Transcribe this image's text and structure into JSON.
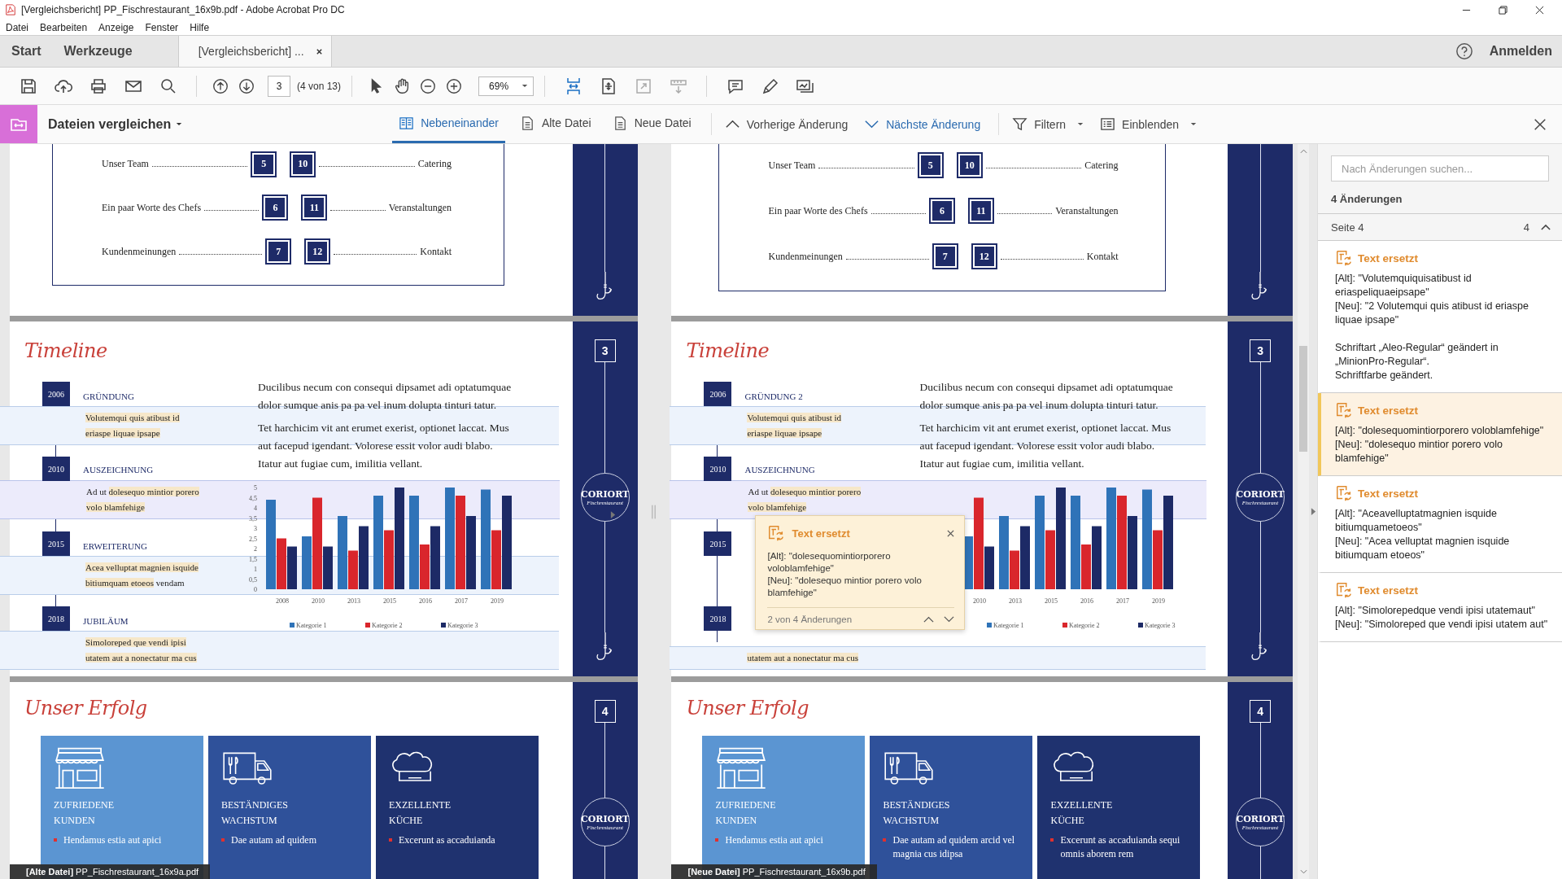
{
  "window": {
    "title": "[Vergleichsbericht] PP_Fischrestaurant_16x9b.pdf - Adobe Acrobat Pro DC"
  },
  "menu": [
    "Datei",
    "Bearbeiten",
    "Anzeige",
    "Fenster",
    "Hilfe"
  ],
  "tabs": [
    {
      "label": "Start",
      "selected": false,
      "kind": "home"
    },
    {
      "label": "Werkzeuge",
      "selected": false,
      "kind": "home"
    },
    {
      "label": "[Vergleichsbericht] ...",
      "selected": true,
      "kind": "document"
    }
  ],
  "account": {
    "label": "Anmelden"
  },
  "toolbar": {
    "page": "3",
    "page_count": "(4 von 13)",
    "zoom": "69%"
  },
  "compare_bar": {
    "title": "Dateien vergleichen",
    "views": [
      {
        "label": "Nebeneinander",
        "selected": true,
        "kind": "split"
      },
      {
        "label": "Alte Datei",
        "selected": false,
        "kind": "doc"
      },
      {
        "label": "Neue Datei",
        "selected": false,
        "kind": "doc"
      }
    ],
    "actions": [
      {
        "label": "Vorherige Änderung",
        "kind": "prev",
        "highlighted": false
      },
      {
        "label": "Nächste Änderung",
        "kind": "next",
        "highlighted": true
      },
      {
        "label": "Filtern",
        "kind": "filter",
        "highlighted": false
      },
      {
        "label": "Einblenden",
        "kind": "show",
        "highlighted": false
      }
    ]
  },
  "panes": [
    {
      "file_label": "**[Alte Datei]** PP_Fischrestaurant_16x9a.pdf",
      "toc": [
        {
          "left": "Unser Team",
          "left_page": "5",
          "right_page": "10",
          "right": "Catering"
        },
        {
          "left": "Ein paar Worte des Chefs",
          "left_page": "6",
          "right_page": "11",
          "right": "Veranstaltungen"
        },
        {
          "left": "Kundenmeinungen",
          "left_page": "7",
          "right_page": "12",
          "right": "Kontakt"
        }
      ],
      "timeline": {
        "title": "Timeline",
        "page": "3",
        "brand": "CORIORT",
        "brand_sub": "Fischrestaurant",
        "entries": [
          {
            "year": "2006",
            "title": "GRÜNDUNG",
            "current": false,
            "lines": [
              [
                {
                  "text": "Volutemqui quis atibust id",
                  "changed": true
                }
              ],
              [
                {
                  "text": "eriaspe liquae ipsape",
                  "changed": true
                }
              ]
            ]
          },
          {
            "year": "2010",
            "title": "AUSZEICHNUNG",
            "current": true,
            "lines": [
              [
                {
                  "text": "Ad ut ",
                  "changed": false
                },
                {
                  "text": "dolesequo mintior porero",
                  "changed": true
                }
              ],
              [
                {
                  "text": "volo blamfehige",
                  "changed": true
                }
              ]
            ]
          },
          {
            "year": "2015",
            "title": "ERWEITERUNG",
            "current": false,
            "lines": [
              [
                {
                  "text": "Acea velluptat magnien isquide",
                  "changed": true
                }
              ],
              [
                {
                  "text": "bitiumquam etoeos",
                  "changed": true
                },
                {
                  "text": " vendam",
                  "changed": false
                }
              ]
            ]
          },
          {
            "year": "2018",
            "title": "JUBILÄUM",
            "current": false,
            "lines": [
              [
                {
                  "text": "Simoloreped que vendi ipisi",
                  "changed": true
                }
              ],
              [
                {
                  "text": "utatem aut a nonectatur ma cus",
                  "changed": true
                }
              ]
            ]
          }
        ],
        "paragraphs": [
          "Ducilibus necum con consequi dipsamet adi optatumquae dolor sumque anis pa pa vel inum dolupta tinturi tatur.",
          "Tet harchicim vit ant erumet exerist, optionet laccat. Mus aut facepud igendant. Volorese essit volor audi blabo. Itatur aut fugiae cum, imilitia vellant."
        ],
        "chart_data": {
          "type": "bar",
          "legend": "bottom",
          "categories": [
            "2008",
            "2010",
            "2013",
            "2015",
            "2016",
            "2017",
            "2019"
          ],
          "ylim": [
            0,
            5
          ],
          "yticks": [
            0,
            {
              "value": 0.5,
              "label": "0,5"
            },
            1,
            {
              "value": 1.5,
              "label": "1,5"
            },
            2,
            {
              "value": 2.5,
              "label": "2,5"
            },
            3,
            {
              "value": 3.5,
              "label": "3,5"
            },
            4,
            {
              "value": 4.5,
              "label": "4,5"
            },
            5
          ],
          "series": [
            {
              "name": "Kategorie 1",
              "color": "#2f73b8",
              "values": [
                4.4,
                2.6,
                3.6,
                4.6,
                4.6,
                5,
                4.9
              ]
            },
            {
              "name": "Kategorie 2",
              "color": "#d9262c",
              "values": [
                2.5,
                4.5,
                1.9,
                2.9,
                2.2,
                4.6,
                2.9
              ]
            },
            {
              "name": "Kategorie 3",
              "color": "#1d2a66",
              "values": [
                2.1,
                2.1,
                3.1,
                5,
                3.1,
                3.6,
                4.6
              ]
            }
          ]
        }
      },
      "success": {
        "title": "Unser Erfolg",
        "page": "4",
        "brand": "CORIORT",
        "brand_sub": "Fischrestaurant",
        "cards": [
          {
            "kind": "shop",
            "color": "#5b95d2",
            "title": "ZUFRIEDENE KUNDEN",
            "bullets": [
              "Hendamus estia aut apici"
            ]
          },
          {
            "kind": "truck",
            "color": "#2f519a",
            "title": "BESTÄNDIGES WACHSTUM",
            "bullets": [
              "Dae autam ad quidem"
            ]
          },
          {
            "kind": "chef",
            "color": "#1f326f",
            "title": "EXZELLENTE KÜCHE",
            "bullets": [
              "Excerunt as accaduianda"
            ]
          }
        ]
      }
    },
    {
      "file_label": "**[Neue Datei]** PP_Fischrestaurant_16x9b.pdf",
      "toc": [
        {
          "left": "Unser Team",
          "left_page": "5",
          "right_page": "10",
          "right": "Catering"
        },
        {
          "left": "Ein paar Worte des Chefs",
          "left_page": "6",
          "right_page": "11",
          "right": "Veranstaltungen"
        },
        {
          "left": "Kundenmeinungen",
          "left_page": "7",
          "right_page": "12",
          "right": "Kontakt"
        }
      ],
      "timeline": {
        "title": "Timeline",
        "page": "3",
        "brand": "CORIORT",
        "brand_sub": "Fischrestaurant",
        "entries": [
          {
            "year": "2006",
            "title": "GRÜNDUNG 2",
            "current": false,
            "lines": [
              [
                {
                  "text": "Volutemqui quis atibust id",
                  "changed": true
                }
              ],
              [
                {
                  "text": "eriaspe liquae ipsape",
                  "changed": true
                }
              ]
            ]
          },
          {
            "year": "2010",
            "title": "AUSZEICHNUNG",
            "current": true,
            "lines": [
              [
                {
                  "text": "Ad ut ",
                  "changed": false
                },
                {
                  "text": "dolesequo mintior porero",
                  "changed": true
                }
              ],
              [
                {
                  "text": "volo blamfehige",
                  "changed": true
                }
              ]
            ]
          },
          {
            "year": "2015"
          },
          {
            "year": "2018",
            "current": false,
            "lines": [
              [
                {
                  "text": "utatem aut a nonectatur ma cus",
                  "changed": true
                }
              ]
            ]
          }
        ],
        "paragraphs": [
          "Ducilibus necum con consequi dipsamet adi optatumquae dolor sumque anis pa pa vel inum dolupta tinturi tatur.",
          "Tet harchicim vit ant erumet exerist, optionet laccat. Mus aut facepud igendant. Volorese essit volor audi blabo. Itatur aut fugiae cum, imilitia vellant."
        ],
        "chart_data": {
          "type": "bar",
          "legend": "bottom",
          "categories": [
            "2010",
            "2013",
            "2015",
            "2016",
            "2017",
            "2019"
          ],
          "ylim": [
            0,
            5
          ],
          "series": [
            {
              "name": "Kategorie 1",
              "color": "#2f73b8",
              "values": [
                2.6,
                3.6,
                4.6,
                4.6,
                5,
                4.9
              ]
            },
            {
              "name": "Kategorie 2",
              "color": "#d9262c",
              "values": [
                4.5,
                1.9,
                2.9,
                2.2,
                4.6,
                2.9
              ]
            },
            {
              "name": "Kategorie 3",
              "color": "#1d2a66",
              "values": [
                2.1,
                3.1,
                5,
                3.1,
                3.6,
                4.6
              ]
            }
          ]
        }
      },
      "success": {
        "title": "Unser Erfolg",
        "page": "4",
        "brand": "CORIORT",
        "brand_sub": "Fischrestaurant",
        "cards": [
          {
            "kind": "shop",
            "color": "#5b95d2",
            "title": "ZUFRIEDENE KUNDEN",
            "bullets": [
              "Hendamus estia aut apici"
            ]
          },
          {
            "kind": "truck",
            "color": "#2f519a",
            "title": "BESTÄNDIGES WACHSTUM",
            "bullets": [
              "Dae autam ad quidem arcid vel magnia cus idipsa"
            ]
          },
          {
            "kind": "chef",
            "color": "#1f326f",
            "title": "EXZELLENTE KÜCHE",
            "bullets": [
              "Excerunt as accaduianda sequi omnis aborem rem"
            ]
          }
        ]
      },
      "popup": {
        "title": "Text ersetzt",
        "lines": [
          "[Alt]: \"dolesequomintiorporero voloblamfehige\"",
          "[Neu]: \"dolesequo mintior porero volo blamfehige\""
        ],
        "footer": "2 von 4 Änderungen"
      }
    }
  ],
  "changes_panel": {
    "search_placeholder": "Nach Änderungen suchen...",
    "count": "4 Änderungen",
    "group": {
      "label": "Seite 4",
      "count": "4",
      "expanded": true
    },
    "changes": [
      {
        "title": "Text ersetzt",
        "selected": false,
        "lines": [
          "[Alt]: \"Volutemquiquisatibust id eriaspeliquaeipsape\"",
          "[Neu]: \"2 Volutemqui quis atibust id eriaspe liquae ipsape\""
        ],
        "note": [
          "Schriftart „Aleo-Regular“ geändert in „MinionPro-Regular“.",
          "Schriftfarbe geändert."
        ]
      },
      {
        "title": "Text ersetzt",
        "selected": true,
        "lines": [
          "[Alt]: \"dolesequomintiorporero voloblamfehige\"",
          "[Neu]: \"dolesequo mintior porero volo blamfehige\""
        ]
      },
      {
        "title": "Text ersetzt",
        "selected": false,
        "lines": [
          "[Alt]: \"Aceavelluptatmagnien isquide bitiumquametoeos\"",
          "[Neu]: \"Acea velluptat magnien isquide bitiumquam etoeos\""
        ]
      },
      {
        "title": "Text ersetzt",
        "selected": false,
        "lines": [
          "[Alt]: \"Simolorepedque vendi ipisi utatemaut\"",
          "[Neu]: \"Simoloreped que vendi ipisi utatem aut\""
        ]
      }
    ]
  }
}
